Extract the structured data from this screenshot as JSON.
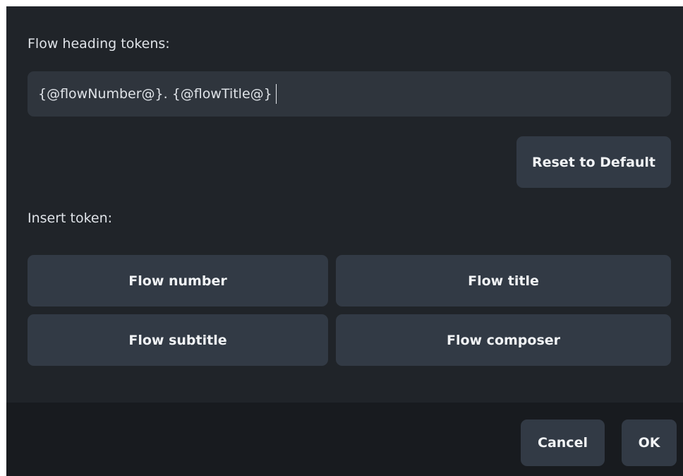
{
  "format": {
    "heading_label": "Flow heading tokens:",
    "heading_value": "{@flowNumber@}. {@flowTitle@}",
    "reset_label": "Reset to Default"
  },
  "tokens": {
    "insert_label": "Insert token:",
    "buttons": [
      {
        "label": "Flow number"
      },
      {
        "label": "Flow title"
      },
      {
        "label": "Flow subtitle"
      },
      {
        "label": "Flow composer"
      }
    ]
  },
  "footer": {
    "cancel_label": "Cancel",
    "ok_label": "OK"
  },
  "colors": {
    "background": "#202429",
    "field": "#2f353d",
    "button": "#323a45",
    "footer": "#181b1f",
    "text": "#dfe3e8"
  }
}
